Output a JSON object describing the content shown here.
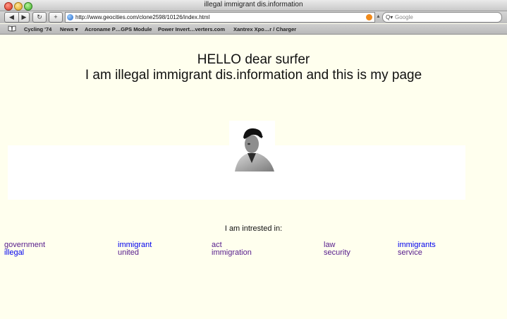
{
  "window": {
    "title": "illegal immigrant dis.information"
  },
  "toolbar": {
    "back_glyph": "◀",
    "forward_glyph": "▶",
    "reload_glyph": "↻",
    "add_glyph": "+",
    "url": "http://www.geocities.com/clone2598/10126/index.html",
    "search_placeholder": "Google",
    "search_glyph": "Q▾"
  },
  "bookmarks": [
    "Cycling '74",
    "News ▾",
    "Acroname P…GPS Module",
    "Power Invert…verters.com",
    "Xantrex Xpo…r / Charger"
  ],
  "page": {
    "heading1": "HELLO dear surfer",
    "heading2": "I am illegal immigrant dis.information and this is my page",
    "interests_label": "I am intrested in:",
    "links": [
      {
        "text": "government",
        "state": "visited"
      },
      {
        "text": "illegal",
        "state": "unvisited"
      },
      {
        "text": "immigrant",
        "state": "unvisited"
      },
      {
        "text": "united",
        "state": "visited"
      },
      {
        "text": "act",
        "state": "visited"
      },
      {
        "text": "immigration",
        "state": "visited"
      },
      {
        "text": "law",
        "state": "visited"
      },
      {
        "text": "security",
        "state": "visited"
      },
      {
        "text": "immigrants",
        "state": "unvisited"
      },
      {
        "text": "service",
        "state": "visited"
      }
    ]
  },
  "colors": {
    "page_background": "#ffffee",
    "visited_link": "#551a8b",
    "unvisited_link": "#0000ee"
  }
}
